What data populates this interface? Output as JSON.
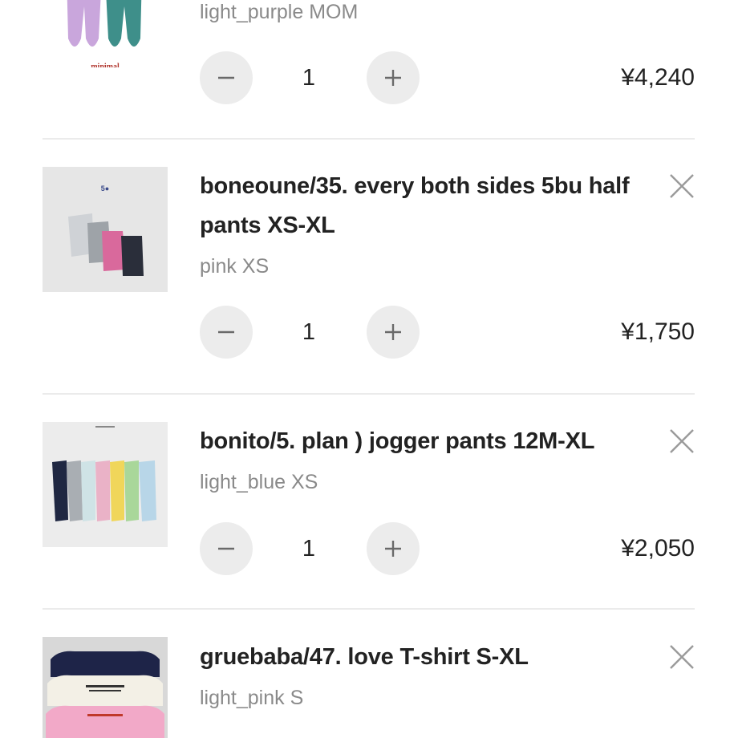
{
  "cart": {
    "items": [
      {
        "title": "",
        "variant": "light_purple MOM",
        "quantity": "1",
        "price": "¥4,240",
        "image_label": "minimal"
      },
      {
        "title": "boneoune/35. every both sides 5bu half pants XS-XL",
        "variant": "pink XS",
        "quantity": "1",
        "price": "¥1,750"
      },
      {
        "title": "bonito/5. plan ) jogger pants 12M-XL",
        "variant": "light_blue XS",
        "quantity": "1",
        "price": "¥2,050"
      },
      {
        "title": "gruebaba/47. love T-shirt S-XL",
        "variant": "light_pink S",
        "quantity": "",
        "price": ""
      }
    ]
  },
  "icons": {
    "remove": "close-icon",
    "decrease": "minus-icon",
    "increase": "plus-icon"
  },
  "colors": {
    "stepper_bg": "#ececec",
    "variant_text": "#8a8a8a",
    "divider": "#ebebeb"
  }
}
